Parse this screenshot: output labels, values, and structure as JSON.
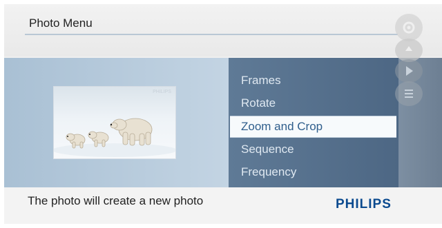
{
  "header": {
    "title": "Photo Menu"
  },
  "menu": {
    "items": [
      {
        "label": "Frames"
      },
      {
        "label": "Rotate"
      },
      {
        "label": "Zoom and Crop"
      },
      {
        "label": "Sequence"
      },
      {
        "label": "Frequency"
      }
    ],
    "selected": "Zoom and Crop"
  },
  "preview": {
    "photo_mark": "PHILIPS",
    "subject": "polar bears on snow"
  },
  "footer": {
    "status": "The photo will create a new photo",
    "brand": "PHILIPS"
  },
  "side_controls": {
    "icons": [
      "settings-icon",
      "up-icon",
      "play-icon",
      "menu-icon"
    ]
  },
  "colors": {
    "accent": "#0b4a8f",
    "menu_bg": "#56708c",
    "selected_text": "#2f5e8c"
  }
}
